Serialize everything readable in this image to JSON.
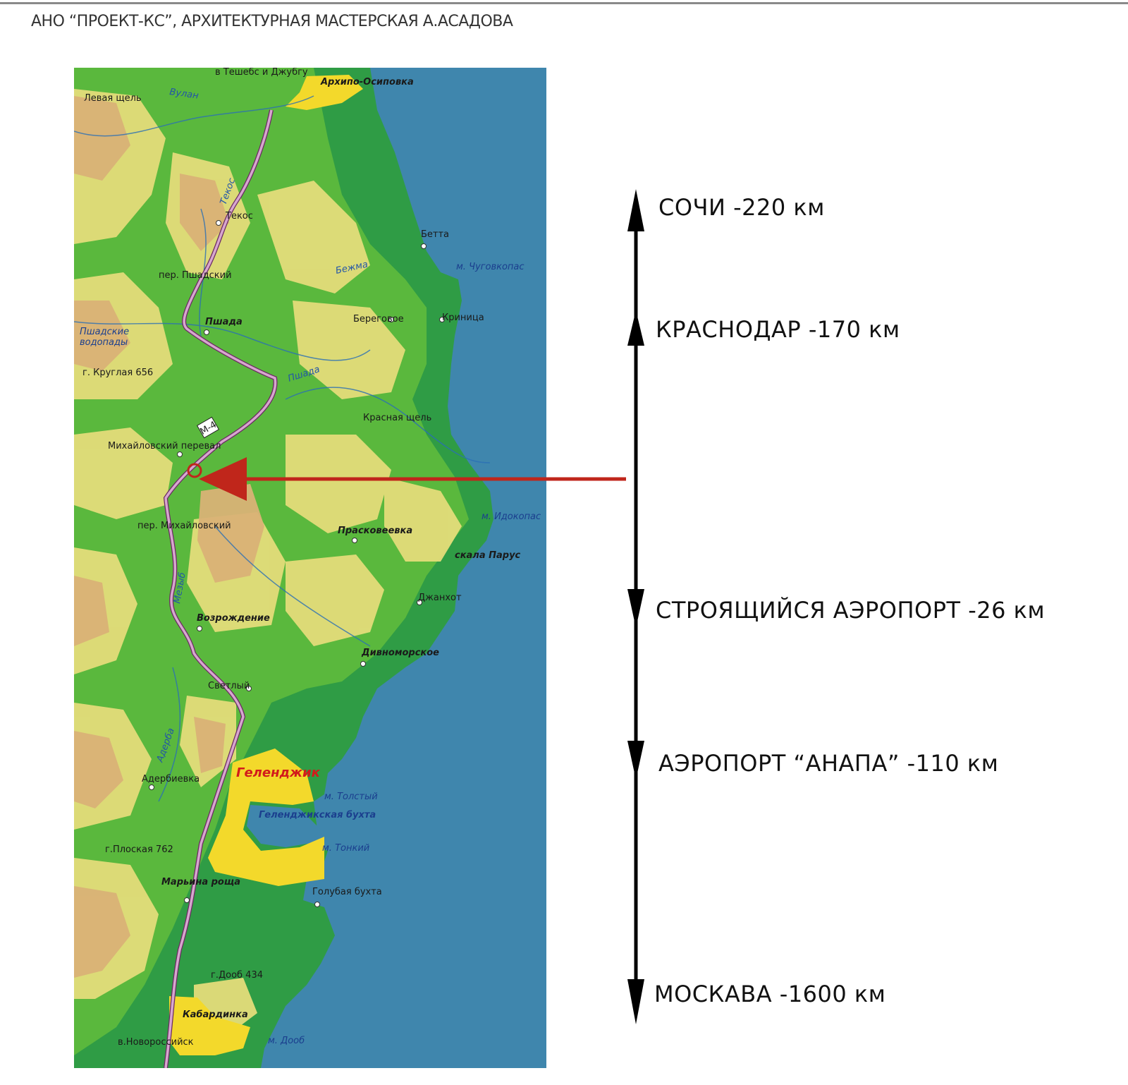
{
  "header": {
    "title": "АНО “ПРОЕКТ-КС”,  АРХИТЕКТУРНАЯ МАСТЕРСКАЯ А.АСАДОВА"
  },
  "colors": {
    "sea": "#3f86ad",
    "lowland_green": "#2f9c45",
    "mid_green": "#5fbb3c",
    "hills_yellow": "#e4dc7a",
    "mountains_tan": "#d9b276",
    "road": "#c890bf",
    "cities": "#f3d92b",
    "pointer_arrow": "#c0261b",
    "scale_arrow": "#000000"
  },
  "map": {
    "labels": {
      "teshebs": "в Тешебс и Джубгу",
      "arkhipo": "Архипо-Осиповка",
      "vulan": "Вулан",
      "levaya": "Левая щель",
      "tekos_river": "Текос",
      "tekos": "Текос",
      "betta": "Бетта",
      "chugovkopas": "м. Чуговкопас",
      "pshadsky_pass": "пер. Пшадский",
      "bezhma": "Бежма",
      "pshada": "Пшада",
      "beregovoe": "Береговое",
      "krinitsa": "Криница",
      "vodopady1": "Пшадские",
      "vodopady2": "водопады",
      "kruglaya": "г. Круглая 656",
      "pshada_river": "Пшада",
      "krasnaya": "Красная щель",
      "m4": "М-4",
      "mikh_pass": "Михайловский перевал",
      "mikh_pass2": "пер. Михайловский",
      "idokopas": "м. Идокопас",
      "praskoveevka": "Прасковеевка",
      "parus": "скала Парус",
      "dzhankhot": "Джанхот",
      "mezyb": "Мезыб",
      "vozrozhdenie": "Возрождение",
      "divnomorskoe": "Дивноморское",
      "svetly": "Светлый",
      "adebiy": "Адерба",
      "aderbievka": "Адербиевка",
      "gelendzhik": "Геленджик",
      "tolsty": "м. Толстый",
      "bay": "Геленджикская бухта",
      "ploskaya": "г.Плоская 762",
      "tonky": "м. Тонкий",
      "maryina": "Марьина роща",
      "golubaya": "Голубая бухта",
      "doob434": "г.Дооб 434",
      "kabardinka": "Кабардинка",
      "novoross": "в.Новороссийск",
      "doob": "м. Дооб"
    }
  },
  "destinations": [
    {
      "label": "СОЧИ  -220 км",
      "direction": "up"
    },
    {
      "label": "КРАСНОДАР -170 км",
      "direction": "up"
    },
    {
      "label": "СТРОЯЩИЙСЯ АЭРОПОРТ -26 км",
      "direction": "down"
    },
    {
      "label": "АЭРОПОРТ “АНАПА”  -110 км",
      "direction": "down"
    },
    {
      "label": "МОСКАВА  -1600 км",
      "direction": "down"
    }
  ]
}
